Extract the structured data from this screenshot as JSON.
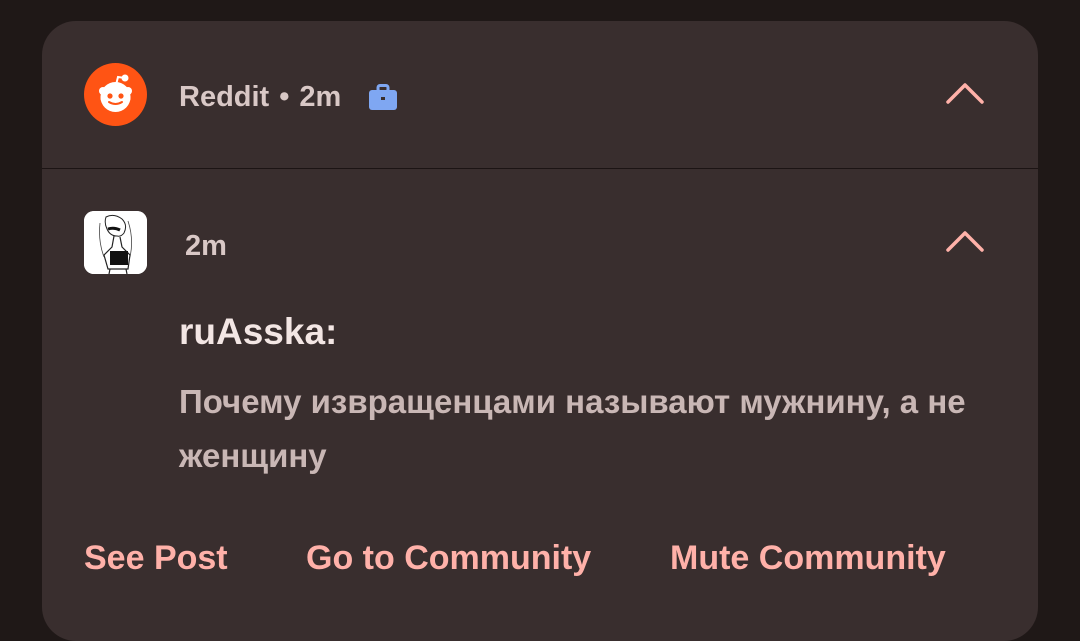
{
  "notification": {
    "app_name": "Reddit",
    "separator": "•",
    "time": "2m",
    "app_icon": "reddit-logo-icon",
    "work_profile_icon": "briefcase-icon",
    "collapse_icon": "chevron-up-icon"
  },
  "message": {
    "time": "2m",
    "avatar": "user-avatar",
    "sender": "ruAsska:",
    "text": "Почему извращенцами называют мужнину, а не женщину"
  },
  "actions": {
    "see_post": "See Post",
    "go_to_community": "Go to Community",
    "mute_community": "Mute Community"
  },
  "colors": {
    "background": "#1f1817",
    "card": "#392e2e",
    "reddit_orange": "#ff5414",
    "action_text": "#ffb1a9",
    "work_badge": "#7fa7f2"
  }
}
